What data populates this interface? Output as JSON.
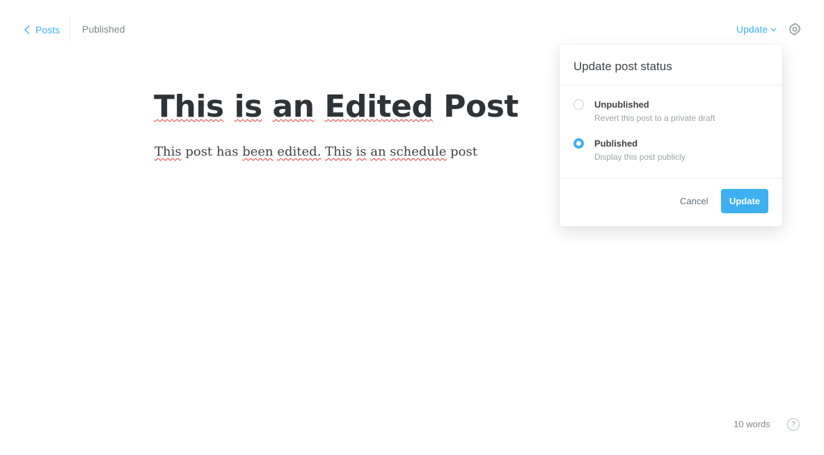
{
  "header": {
    "back_label": "Posts",
    "status": "Published",
    "update_label": "Update"
  },
  "editor": {
    "title": "This is an Edited Post",
    "body_words": [
      "This",
      "post",
      "has",
      "been",
      "edited.",
      "This",
      "is",
      "an",
      "schedule",
      "post"
    ]
  },
  "popover": {
    "title": "Update post status",
    "options": [
      {
        "label": "Unpublished",
        "description": "Revert this post to a private draft",
        "selected": false
      },
      {
        "label": "Published",
        "description": "Display this post publicly",
        "selected": true
      }
    ],
    "cancel_label": "Cancel",
    "confirm_label": "Update"
  },
  "footer": {
    "word_count": "10 words",
    "help_label": "?"
  },
  "colors": {
    "accent": "#3eb0ef",
    "muted_text": "#7d878a",
    "spellcheck": "#e03131"
  }
}
